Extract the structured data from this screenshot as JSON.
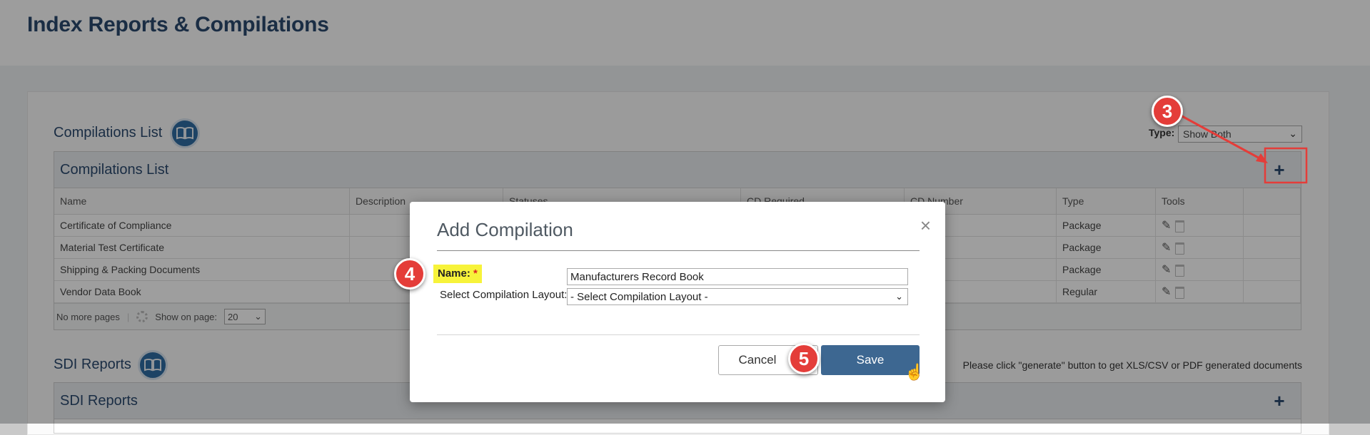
{
  "page": {
    "title": "Index Reports & Compilations"
  },
  "compilations": {
    "section_title": "Compilations List",
    "panel_title": "Compilations List",
    "type_label": "Type:",
    "type_value": "Show Both",
    "columns": [
      "Name",
      "Description",
      "Statuses",
      "CD Required",
      "CD Number",
      "Type",
      "Tools"
    ],
    "rows": [
      {
        "name": "Certificate of Compliance",
        "type": "Package"
      },
      {
        "name": "Material Test Certificate",
        "type": "Package"
      },
      {
        "name": "Shipping & Packing Documents",
        "type": "Package"
      },
      {
        "name": "Vendor Data Book",
        "type": "Regular"
      }
    ],
    "pager": {
      "no_more": "No more pages",
      "show_on_page": "Show on page:",
      "page_size": "20"
    }
  },
  "sdi": {
    "section_title": "SDI Reports",
    "panel_title": "SDI Reports",
    "note": "Please click \"generate\" button to get XLS/CSV or PDF generated documents"
  },
  "modal": {
    "title": "Add Compilation",
    "name_label": "Name:",
    "required_mark": "*",
    "name_value": "Manufacturers Record Book",
    "layout_label": "Select Compilation Layout:",
    "layout_value": "- Select Compilation Layout -",
    "cancel_label": "Cancel",
    "save_label": "Save"
  },
  "annotations": {
    "step3": "3",
    "step4": "4",
    "step5": "5"
  },
  "colors": {
    "accent": "#3d6791",
    "brand": "#2b4a6f",
    "annotation": "#e43d39",
    "highlight": "#f7f33a"
  }
}
